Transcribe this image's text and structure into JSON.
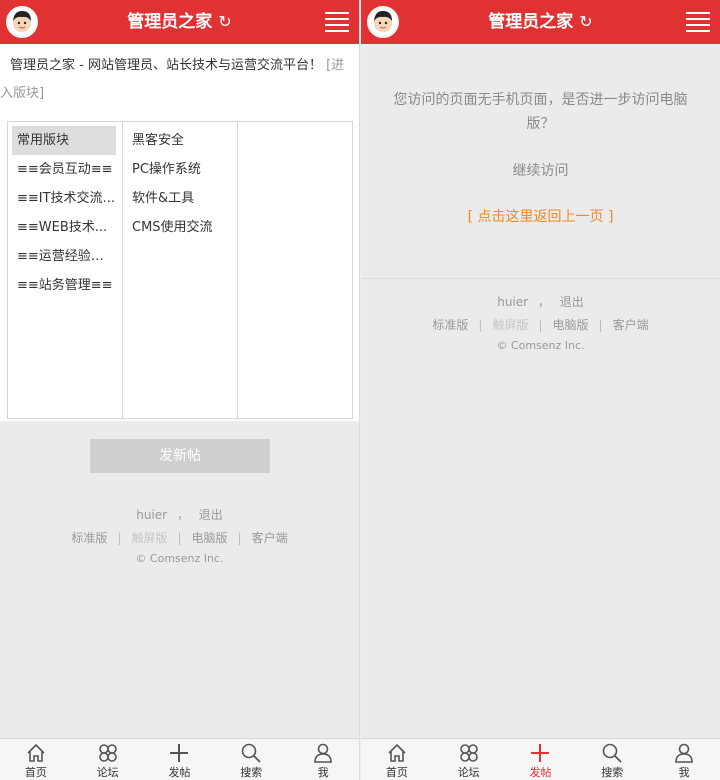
{
  "app": {
    "title": "管理员之家"
  },
  "icons": {
    "avatar": "avatar-icon",
    "refresh": "refresh-icon",
    "menu": "menu-icon"
  },
  "colors": {
    "header": "#e03232",
    "link": "#f08a1c",
    "active_nav": "#e03232"
  },
  "left": {
    "description": "管理员之家 - 网站管理员、站长技术与运营交流平台！",
    "description_tail": "[进入版块]",
    "categories": [
      "常用版块",
      "≡≡会员互动≡≡",
      "≡≡IT技术交流...",
      "≡≡WEB技术...",
      "≡≡运营经验交...",
      "≡≡站务管理≡≡"
    ],
    "subforums": [
      "黑客安全",
      "PC操作系统",
      "软件&工具",
      "CMS使用交流"
    ],
    "post_button": "发新帖"
  },
  "right": {
    "notice": "您访问的页面无手机页面，是否进一步访问电脑版？",
    "continue": "继续访问",
    "back": "[ 点击这里返回上一页 ]"
  },
  "footer": {
    "user": "huier",
    "sep": "，",
    "logout": "退出",
    "links": [
      "标准版",
      "触屏版",
      "电脑版",
      "客户端"
    ],
    "link_sep": "|",
    "copyright": "© Comsenz Inc."
  },
  "nav": [
    "首页",
    "论坛",
    "发帖",
    "搜索",
    "我"
  ]
}
